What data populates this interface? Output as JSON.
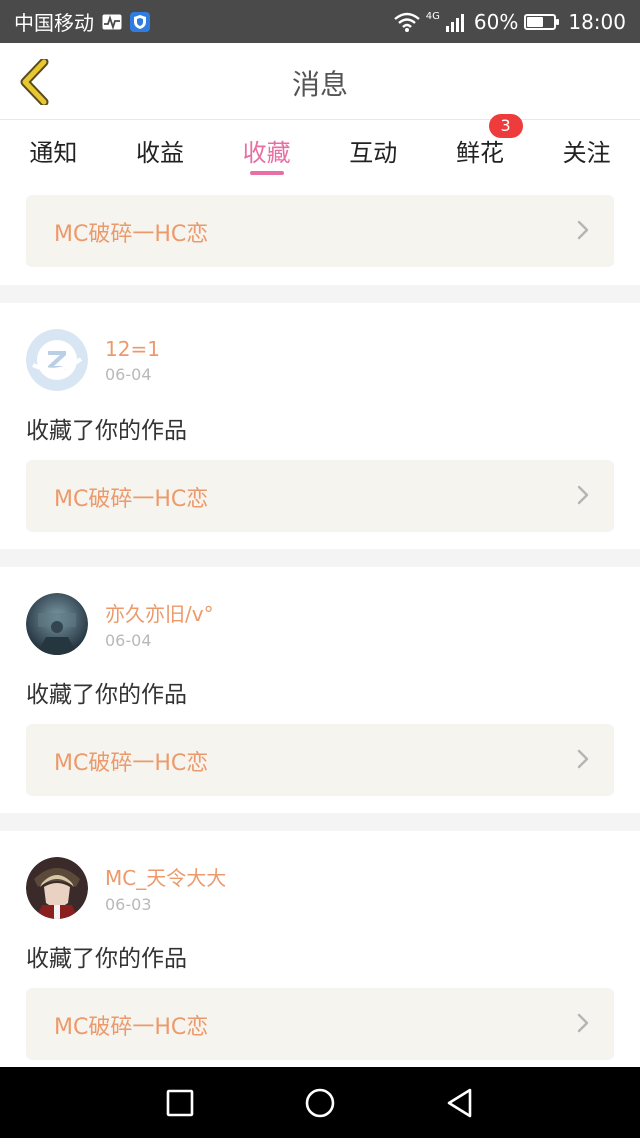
{
  "status_bar": {
    "carrier": "中国移动",
    "network_type": "4G",
    "battery_percent_text": "60%",
    "battery_level": 0.6,
    "time": "18:00",
    "icons": [
      "activity-icon",
      "shield-icon",
      "wifi-icon",
      "signal-icon",
      "battery-icon"
    ]
  },
  "header": {
    "title": "消息",
    "back_icon": "chevron-left-icon",
    "accent_color": "#e8c832"
  },
  "tabs": [
    {
      "label": "通知",
      "active": false
    },
    {
      "label": "收益",
      "active": false
    },
    {
      "label": "收藏",
      "active": true
    },
    {
      "label": "互动",
      "active": false
    },
    {
      "label": "鲜花",
      "active": false,
      "badge": "3"
    },
    {
      "label": "关注",
      "active": false
    }
  ],
  "colors": {
    "active_tab": "#e86fa3",
    "username": "#ec9a6c",
    "badge": "#ee3b3b",
    "link_bg": "#f5f4ee"
  },
  "feed": {
    "first_card": {
      "work_title": "MC破碎一HC恋"
    },
    "messages": [
      {
        "username": "12=1",
        "date": "06-04",
        "action": "收藏了你的作品",
        "work_title": "MC破碎一HC恋",
        "avatar": "default-avatar-icon"
      },
      {
        "username": "亦久亦旧/v°",
        "date": "06-04",
        "action": "收藏了你的作品",
        "work_title": "MC破碎一HC恋",
        "avatar": "photo-avatar"
      },
      {
        "username": "MC_天令大大",
        "date": "06-03",
        "action": "收藏了你的作品",
        "work_title": "MC破碎一HC恋",
        "avatar": "anime-avatar"
      }
    ]
  },
  "nav_bar": {
    "buttons": [
      "recent-apps-icon",
      "home-icon",
      "back-icon"
    ]
  }
}
